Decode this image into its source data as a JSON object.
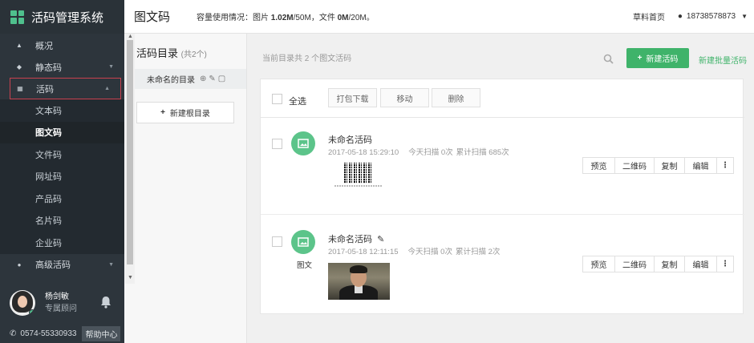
{
  "app": {
    "title": "活码管理系统"
  },
  "sidebar": {
    "items": [
      {
        "label": "概况",
        "icon": "home-icon"
      },
      {
        "label": "静态码",
        "icon": "layers-icon"
      },
      {
        "label": "活码",
        "icon": "grid-icon"
      },
      {
        "label": "高级活码",
        "icon": "cube-icon"
      }
    ],
    "sub_items": [
      "文本码",
      "图文码",
      "文件码",
      "网址码",
      "产品码",
      "名片码",
      "企业码"
    ],
    "active_sub": "图文码"
  },
  "user": {
    "name": "杨剑敏",
    "role": "专属顾问"
  },
  "footer": {
    "phone": "0574-55330933",
    "help": "帮助中心"
  },
  "header": {
    "title": "图文码",
    "quota_prefix": "容量使用情况：图片 ",
    "quota_img_used": "1.02M",
    "quota_img_total": "/50M，文件 ",
    "quota_file_used": "0M",
    "quota_file_total": "/20M。",
    "home": "草料首页",
    "account": "18738578873"
  },
  "directory": {
    "title": "活码目录",
    "count": "(共2个)",
    "item": "未命名的目录",
    "new_root": "新建根目录"
  },
  "main": {
    "info": "当前目录共 2 个图文活码",
    "new_button": "新建活码",
    "batch_link": "新建批量活码",
    "select_all": "全选",
    "toolbar": [
      "打包下载",
      "移动",
      "删除"
    ],
    "rows": [
      {
        "name": "未命名活码",
        "date": "2017-05-18 15:29:10",
        "today": "今天扫描 0次",
        "total": "累计扫描 685次",
        "type_label": ""
      },
      {
        "name": "未命名活码",
        "date": "2017-05-18 12:11:15",
        "today": "今天扫描 0次",
        "total": "累计扫描 2次",
        "type_label": "图文"
      }
    ],
    "actions": [
      "预览",
      "二维码",
      "复制",
      "编辑",
      "⋮"
    ]
  },
  "colors": {
    "accent": "#3fb36a",
    "sidebar": "#2d353c",
    "active_border": "#c9414f"
  }
}
